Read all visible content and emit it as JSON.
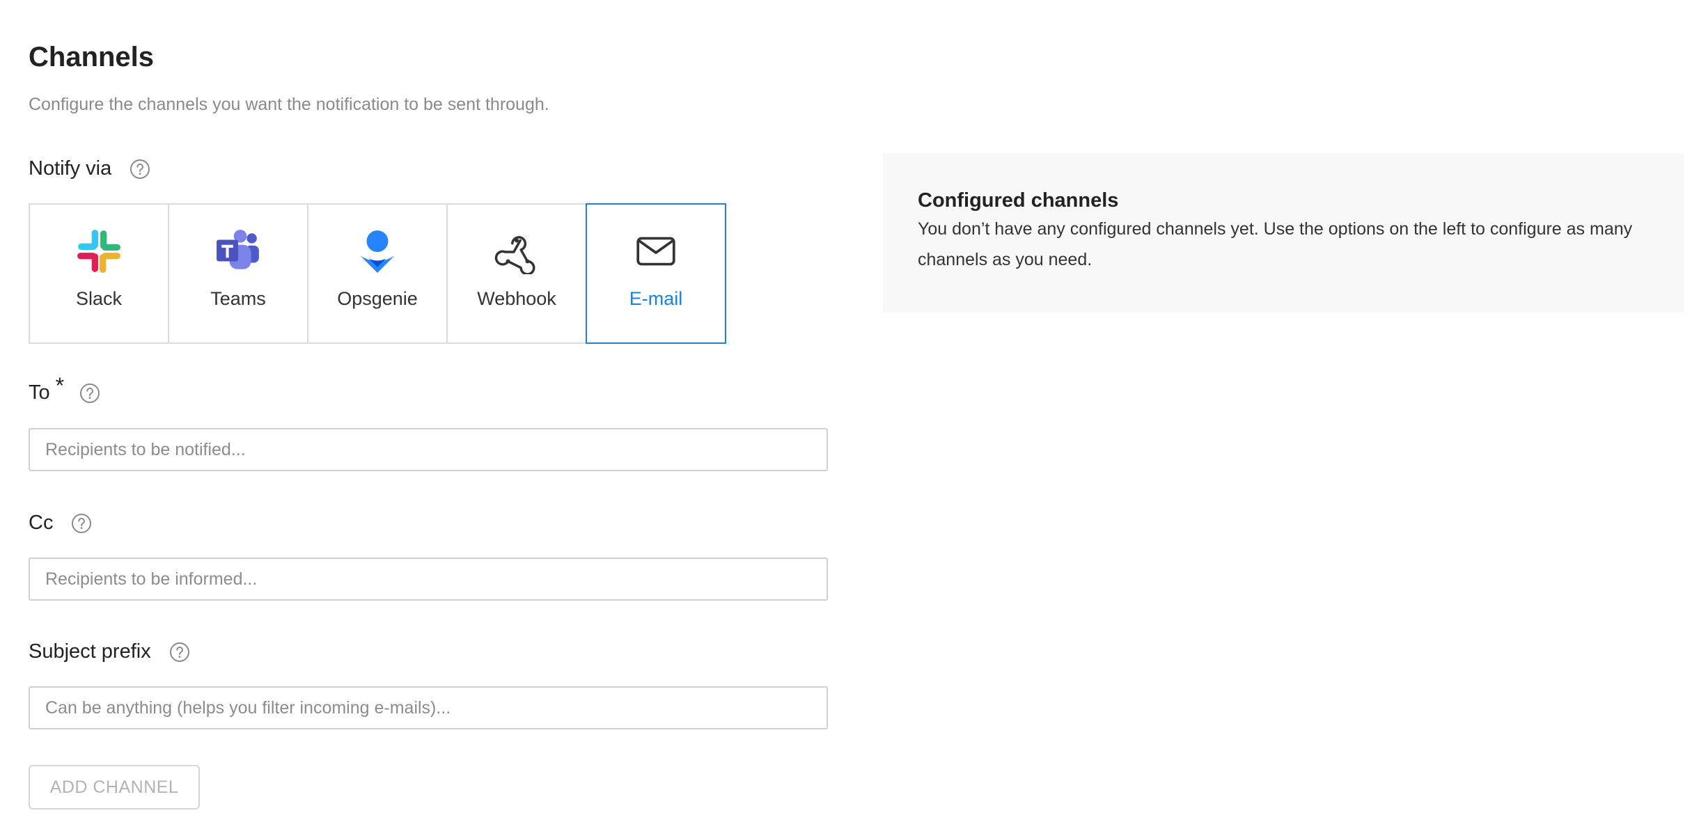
{
  "page": {
    "title": "Channels",
    "subtitle": "Configure the channels you want the notification to be sent through."
  },
  "notify": {
    "label": "Notify via",
    "selected": "E-mail",
    "channels": [
      {
        "label": "Slack",
        "icon": "slack-icon",
        "selected": false
      },
      {
        "label": "Teams",
        "icon": "teams-icon",
        "selected": false
      },
      {
        "label": "Opsgenie",
        "icon": "opsgenie-icon",
        "selected": false
      },
      {
        "label": "Webhook",
        "icon": "webhook-icon",
        "selected": false
      },
      {
        "label": "E-mail",
        "icon": "mail-icon",
        "selected": true
      }
    ]
  },
  "form": {
    "to": {
      "label": "To",
      "required_marker": "*",
      "value": "",
      "placeholder": "Recipients to be notified..."
    },
    "cc": {
      "label": "Cc",
      "value": "",
      "placeholder": "Recipients to be informed..."
    },
    "subject_prefix": {
      "label": "Subject prefix",
      "value": "",
      "placeholder": "Can be anything (helps you filter incoming e-mails)..."
    }
  },
  "actions": {
    "add_channel_label": "ADD CHANNEL",
    "add_channel_disabled": true
  },
  "configured": {
    "title": "Configured channels",
    "text": "You don’t have any configured channels yet. Use the options on the left to configure as many channels as you need."
  },
  "colors": {
    "accent": "#1a82d8",
    "panel_bg": "#f8f8f8",
    "border": "#d0d0d0",
    "muted_text": "#8a8a8a"
  }
}
